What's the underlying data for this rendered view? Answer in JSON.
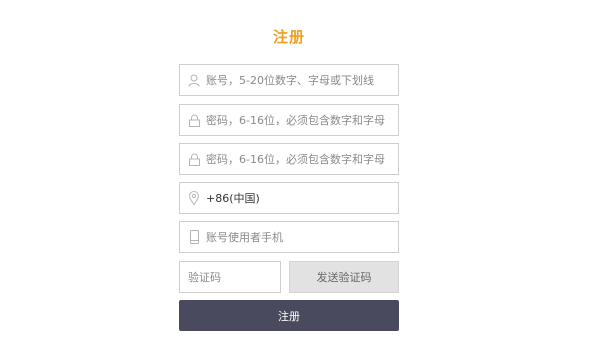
{
  "form": {
    "title": "注册",
    "account_placeholder": "账号，5-20位数字、字母或下划线",
    "password_placeholder": "密码，6-16位，必须包含数字和字母",
    "confirm_password_placeholder": "密码，6-16位，必须包含数字和字母",
    "region_value": "+86(中国)",
    "phone_placeholder": "账号使用者手机",
    "code_placeholder": "验证码",
    "send_code_label": "发送验证码",
    "submit_label": "注册"
  },
  "colors": {
    "title": "#f0a020",
    "submit_bg": "#4a4a5e",
    "send_bg": "#e2e2e2",
    "border": "#cfcfcf"
  },
  "icons": [
    "user-icon",
    "lock-icon",
    "lock-icon",
    "location-icon",
    "phone-icon"
  ]
}
